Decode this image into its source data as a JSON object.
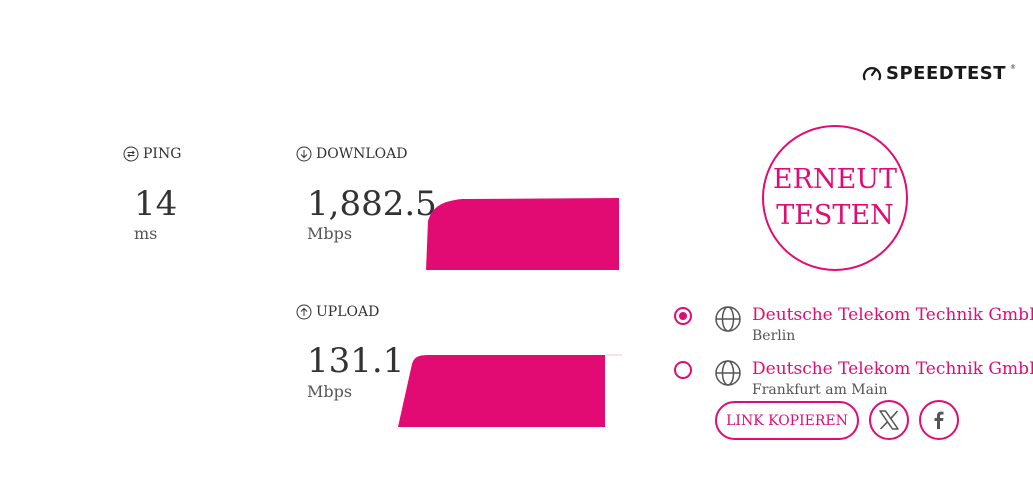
{
  "brand": {
    "name": "SPEEDTEST",
    "trademark": "®",
    "accent": "#e20b74"
  },
  "ping": {
    "label": "PING",
    "value": "14",
    "unit": "ms"
  },
  "download": {
    "label": "DOWNLOAD",
    "value": "1,882.5",
    "unit": "Mbps"
  },
  "upload": {
    "label": "UPLOAD",
    "value": "131.1",
    "unit": "Mbps"
  },
  "retest": {
    "line1": "ERNEUT",
    "line2": "TESTEN"
  },
  "servers": [
    {
      "name": "Deutsche Telekom Technik GmbH",
      "city": "Berlin",
      "selected": true
    },
    {
      "name": "Deutsche Telekom Technik GmbH",
      "city": "Frankfurt am Main",
      "selected": false
    }
  ],
  "share": {
    "copy_link_label": "LINK KOPIEREN",
    "icons": [
      "x-icon",
      "facebook-icon"
    ]
  }
}
